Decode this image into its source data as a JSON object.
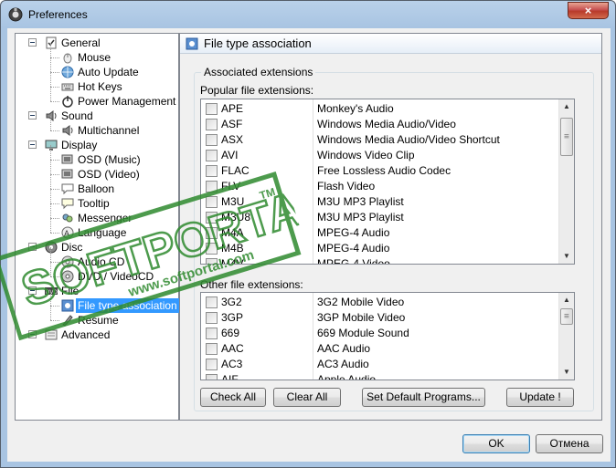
{
  "window": {
    "title": "Preferences",
    "close_glyph": "×"
  },
  "tree": {
    "items": [
      {
        "label": "General",
        "icon": "checkbox-icon",
        "level": 0
      },
      {
        "label": "Mouse",
        "icon": "mouse-icon",
        "level": 1
      },
      {
        "label": "Auto Update",
        "icon": "globe-icon",
        "level": 1
      },
      {
        "label": "Hot Keys",
        "icon": "keyboard-icon",
        "level": 1
      },
      {
        "label": "Power Management",
        "icon": "power-icon",
        "level": 1
      },
      {
        "label": "Sound",
        "icon": "speaker-icon",
        "level": 0
      },
      {
        "label": "Multichannel",
        "icon": "speaker-icon",
        "level": 1
      },
      {
        "label": "Display",
        "icon": "display-icon",
        "level": 0
      },
      {
        "label": "OSD (Music)",
        "icon": "osd-icon",
        "level": 1
      },
      {
        "label": "OSD (Video)",
        "icon": "osd-icon",
        "level": 1
      },
      {
        "label": "Balloon",
        "icon": "balloon-icon",
        "level": 1
      },
      {
        "label": "Tooltip",
        "icon": "tooltip-icon",
        "level": 1
      },
      {
        "label": "Messenger",
        "icon": "messenger-icon",
        "level": 1
      },
      {
        "label": "Language",
        "icon": "language-icon",
        "level": 1
      },
      {
        "label": "Disc",
        "icon": "disc-icon",
        "level": 0
      },
      {
        "label": "Audio CD",
        "icon": "cd-icon",
        "level": 1
      },
      {
        "label": "DVD / VideoCD",
        "icon": "dvd-icon",
        "level": 1
      },
      {
        "label": "File",
        "icon": "file-icon",
        "level": 0
      },
      {
        "label": "File type association",
        "icon": "file-assoc-icon",
        "level": 1,
        "selected": true
      },
      {
        "label": "Resume",
        "icon": "resume-icon",
        "level": 1
      },
      {
        "label": "Advanced",
        "icon": "advanced-icon",
        "level": 0
      }
    ]
  },
  "panel": {
    "title": "File type association",
    "group_title": "Associated extensions",
    "popular_label": "Popular file extensions:",
    "other_label": "Other file extensions:",
    "popular": [
      {
        "ext": "APE",
        "desc": "Monkey's Audio"
      },
      {
        "ext": "ASF",
        "desc": "Windows Media Audio/Video"
      },
      {
        "ext": "ASX",
        "desc": "Windows Media Audio/Video Shortcut"
      },
      {
        "ext": "AVI",
        "desc": "Windows Video Clip"
      },
      {
        "ext": "FLAC",
        "desc": "Free Lossless Audio Codec"
      },
      {
        "ext": "FLV",
        "desc": "Flash Video"
      },
      {
        "ext": "M3U",
        "desc": "M3U MP3 Playlist"
      },
      {
        "ext": "M3U8",
        "desc": "M3U MP3 Playlist"
      },
      {
        "ext": "M4A",
        "desc": "MPEG-4 Audio"
      },
      {
        "ext": "M4B",
        "desc": "MPEG-4 Audio"
      },
      {
        "ext": "M4V",
        "desc": "MPEG-4 Video"
      }
    ],
    "other": [
      {
        "ext": "3G2",
        "desc": "3G2 Mobile Video"
      },
      {
        "ext": "3GP",
        "desc": "3GP Mobile Video"
      },
      {
        "ext": "669",
        "desc": "669 Module Sound"
      },
      {
        "ext": "AAC",
        "desc": "AAC Audio"
      },
      {
        "ext": "AC3",
        "desc": "AC3 Audio"
      },
      {
        "ext": "AIF",
        "desc": "Apple Audio"
      }
    ],
    "buttons": {
      "check_all": "Check All",
      "clear_all": "Clear All",
      "set_default": "Set Default Programs...",
      "update": "Update !"
    }
  },
  "footer": {
    "ok": "OK",
    "cancel": "Отмена"
  },
  "watermark": {
    "brand": "SOFTPORTAL",
    "tm": "TM",
    "url": "www.softportal.com"
  },
  "colors": {
    "selection": "#3399ff",
    "watermark": "#2f8a2f",
    "title_bar": "#b9d1ea"
  }
}
